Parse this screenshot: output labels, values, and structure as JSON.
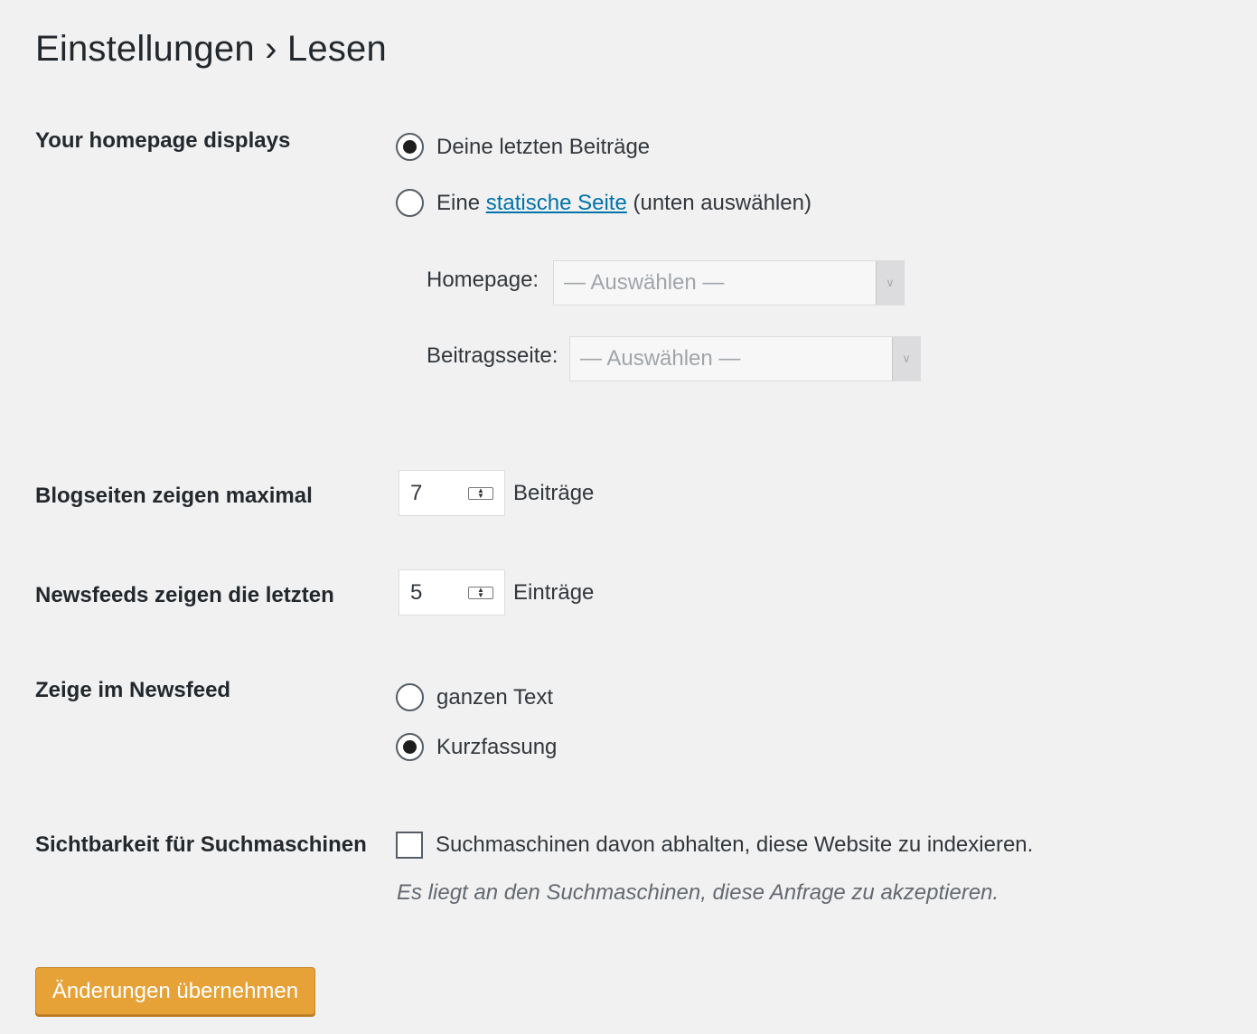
{
  "page": {
    "title": "Einstellungen › Lesen"
  },
  "homepage": {
    "label": "Your homepage displays",
    "option_posts": "Deine letzten Beiträge",
    "option_static_prefix": "Eine",
    "option_static_link": "statische Seite",
    "option_static_suffix": "(unten auswählen)",
    "selected": "posts",
    "homepage_label": "Homepage:",
    "homepage_value": "— Auswählen —",
    "postspage_label": "Beitragsseite:",
    "postspage_value": "— Auswählen —"
  },
  "blog_pages": {
    "label": "Blogseiten zeigen maximal",
    "value": "7",
    "unit": "Beiträge"
  },
  "feeds": {
    "label": "Newsfeeds zeigen die letzten",
    "value": "5",
    "unit": "Einträge"
  },
  "feed_content": {
    "label": "Zeige im Newsfeed",
    "option_full": "ganzen Text",
    "option_summary": "Kurzfassung",
    "selected": "summary"
  },
  "search_visibility": {
    "label": "Sichtbarkeit für Suchmaschinen",
    "checkbox_label": "Suchmaschinen davon abhalten, diese Website zu indexieren.",
    "checked": false,
    "description": "Es liegt an den Suchmaschinen, diese Anfrage zu akzeptieren."
  },
  "actions": {
    "save_label": "Änderungen übernehmen"
  },
  "colors": {
    "background": "#f1f1f1",
    "link": "#0073aa",
    "button": "#e6a236"
  }
}
